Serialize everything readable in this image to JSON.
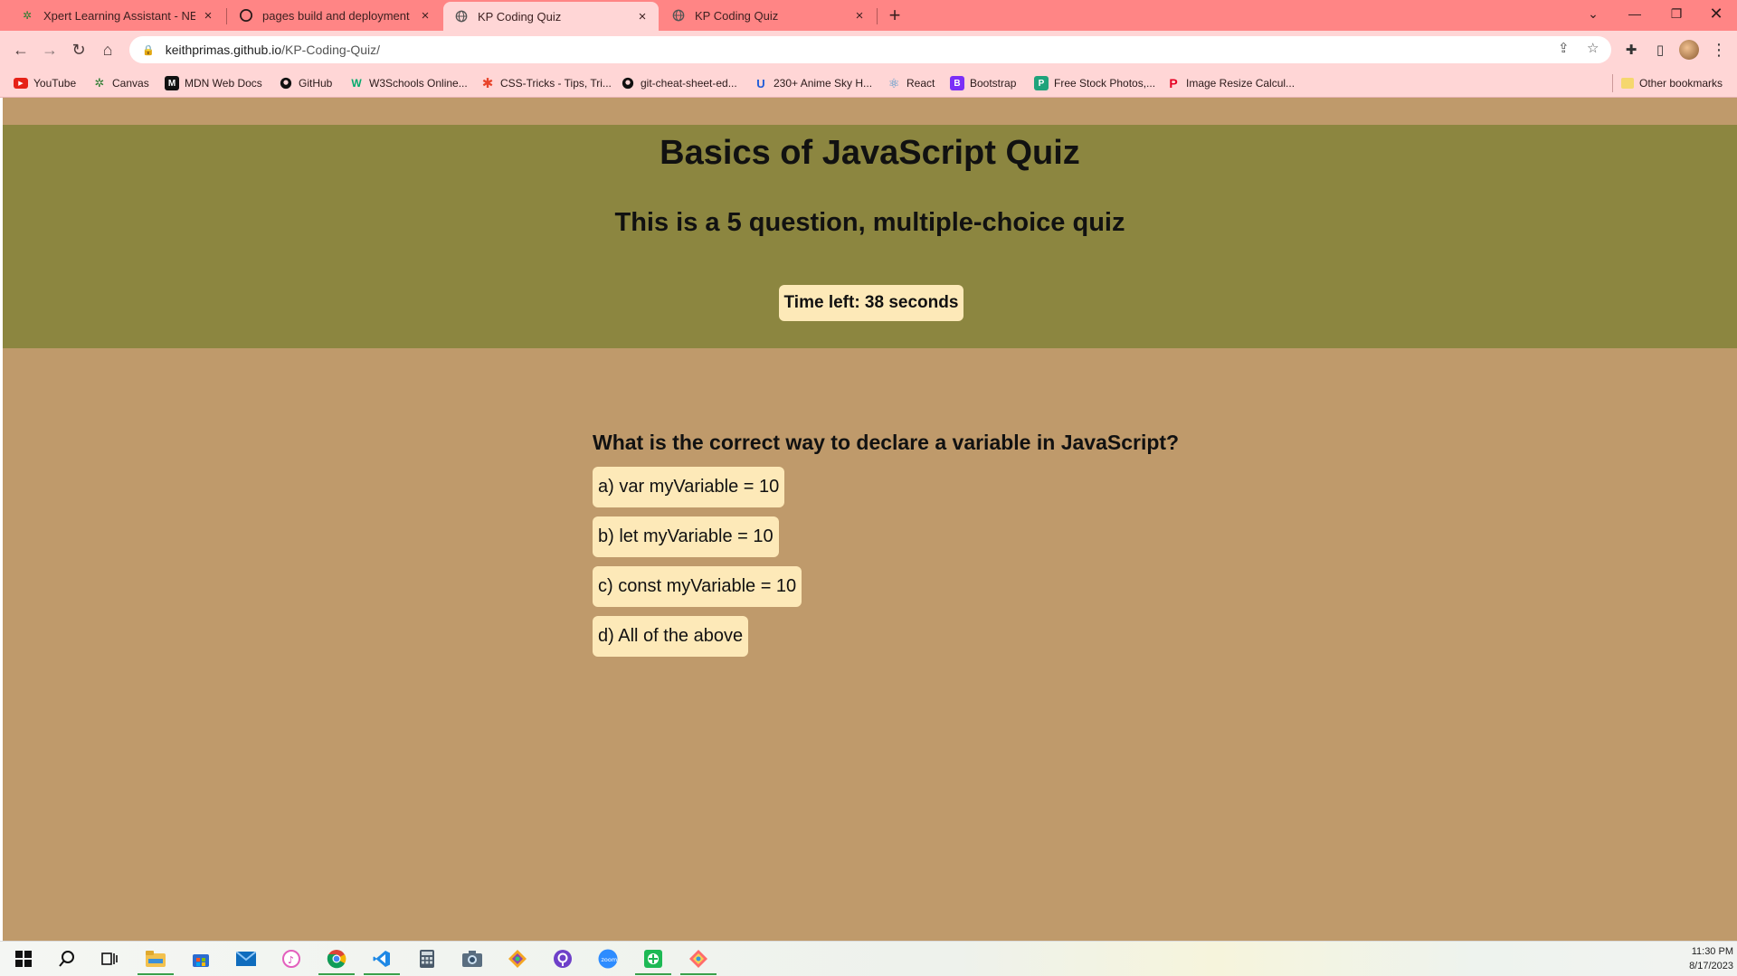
{
  "browser": {
    "tabs": [
      {
        "title": "Xpert Learning Assistant - NEW!",
        "icon": "canvas-icon",
        "active": false
      },
      {
        "title": "pages build and deployment · ke",
        "icon": "github-icon",
        "active": false
      },
      {
        "title": "KP Coding Quiz",
        "icon": "globe-icon",
        "active": true
      },
      {
        "title": "KP Coding Quiz",
        "icon": "globe-icon",
        "active": false
      }
    ],
    "url_host": "keithprimas.github.io",
    "url_path": "/KP-Coding-Quiz/",
    "bookmarks": [
      {
        "label": "YouTube",
        "icon": "youtube-icon"
      },
      {
        "label": "Canvas",
        "icon": "canvas-icon"
      },
      {
        "label": "MDN Web Docs",
        "icon": "mdn-icon"
      },
      {
        "label": "GitHub",
        "icon": "github-icon"
      },
      {
        "label": "W3Schools Online...",
        "icon": "w3schools-icon"
      },
      {
        "label": "CSS-Tricks - Tips, Tri...",
        "icon": "csstricks-icon"
      },
      {
        "label": "git-cheat-sheet-ed...",
        "icon": "github-icon"
      },
      {
        "label": "230+ Anime Sky H...",
        "icon": "bookmark-u-icon"
      },
      {
        "label": "React",
        "icon": "react-icon"
      },
      {
        "label": "Bootstrap",
        "icon": "bootstrap-icon"
      },
      {
        "label": "Free Stock Photos,...",
        "icon": "photos-icon"
      },
      {
        "label": "Image Resize Calcul...",
        "icon": "pinterest-icon"
      }
    ],
    "other_bookmarks": "Other bookmarks"
  },
  "quiz": {
    "title": "Basics of JavaScript Quiz",
    "subtitle": "This is a 5 question, multiple-choice quiz",
    "timer": "Time left: 38 seconds",
    "question": "What is the correct way to declare a variable in JavaScript?",
    "choices": [
      "a) var myVariable = 10",
      "b) let myVariable = 10",
      "c) const myVariable = 10",
      "d) All of the above"
    ]
  },
  "taskbar": {
    "time": "11:30 PM",
    "date": "8/17/2023"
  },
  "colors": {
    "tabstrip": "#ff8585",
    "toolbar": "#ffd6d6",
    "page_bg": "#bf9a6b",
    "header_bg": "#8c8640",
    "card_bg": "#fde9b8"
  }
}
